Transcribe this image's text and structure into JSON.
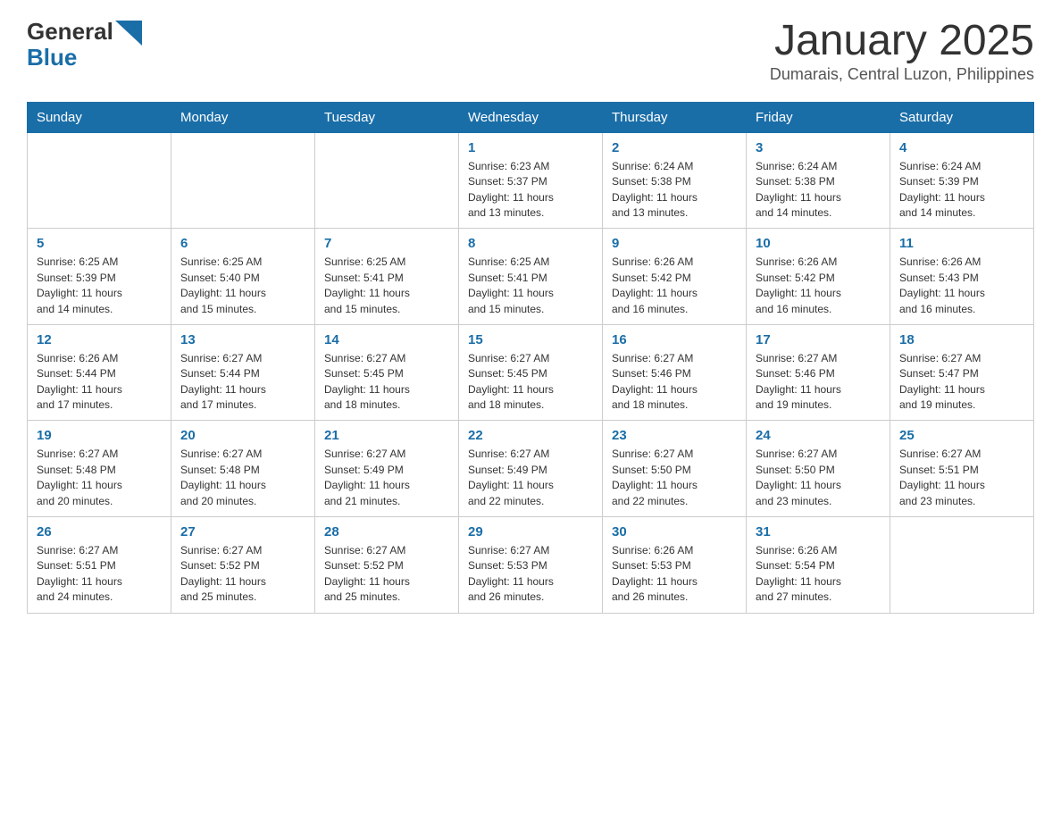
{
  "header": {
    "logo": {
      "text1": "General",
      "text2": "Blue"
    },
    "title": "January 2025",
    "location": "Dumarais, Central Luzon, Philippines"
  },
  "days_of_week": [
    "Sunday",
    "Monday",
    "Tuesday",
    "Wednesday",
    "Thursday",
    "Friday",
    "Saturday"
  ],
  "weeks": [
    {
      "days": [
        {
          "num": "",
          "info": ""
        },
        {
          "num": "",
          "info": ""
        },
        {
          "num": "",
          "info": ""
        },
        {
          "num": "1",
          "info": "Sunrise: 6:23 AM\nSunset: 5:37 PM\nDaylight: 11 hours\nand 13 minutes."
        },
        {
          "num": "2",
          "info": "Sunrise: 6:24 AM\nSunset: 5:38 PM\nDaylight: 11 hours\nand 13 minutes."
        },
        {
          "num": "3",
          "info": "Sunrise: 6:24 AM\nSunset: 5:38 PM\nDaylight: 11 hours\nand 14 minutes."
        },
        {
          "num": "4",
          "info": "Sunrise: 6:24 AM\nSunset: 5:39 PM\nDaylight: 11 hours\nand 14 minutes."
        }
      ]
    },
    {
      "days": [
        {
          "num": "5",
          "info": "Sunrise: 6:25 AM\nSunset: 5:39 PM\nDaylight: 11 hours\nand 14 minutes."
        },
        {
          "num": "6",
          "info": "Sunrise: 6:25 AM\nSunset: 5:40 PM\nDaylight: 11 hours\nand 15 minutes."
        },
        {
          "num": "7",
          "info": "Sunrise: 6:25 AM\nSunset: 5:41 PM\nDaylight: 11 hours\nand 15 minutes."
        },
        {
          "num": "8",
          "info": "Sunrise: 6:25 AM\nSunset: 5:41 PM\nDaylight: 11 hours\nand 15 minutes."
        },
        {
          "num": "9",
          "info": "Sunrise: 6:26 AM\nSunset: 5:42 PM\nDaylight: 11 hours\nand 16 minutes."
        },
        {
          "num": "10",
          "info": "Sunrise: 6:26 AM\nSunset: 5:42 PM\nDaylight: 11 hours\nand 16 minutes."
        },
        {
          "num": "11",
          "info": "Sunrise: 6:26 AM\nSunset: 5:43 PM\nDaylight: 11 hours\nand 16 minutes."
        }
      ]
    },
    {
      "days": [
        {
          "num": "12",
          "info": "Sunrise: 6:26 AM\nSunset: 5:44 PM\nDaylight: 11 hours\nand 17 minutes."
        },
        {
          "num": "13",
          "info": "Sunrise: 6:27 AM\nSunset: 5:44 PM\nDaylight: 11 hours\nand 17 minutes."
        },
        {
          "num": "14",
          "info": "Sunrise: 6:27 AM\nSunset: 5:45 PM\nDaylight: 11 hours\nand 18 minutes."
        },
        {
          "num": "15",
          "info": "Sunrise: 6:27 AM\nSunset: 5:45 PM\nDaylight: 11 hours\nand 18 minutes."
        },
        {
          "num": "16",
          "info": "Sunrise: 6:27 AM\nSunset: 5:46 PM\nDaylight: 11 hours\nand 18 minutes."
        },
        {
          "num": "17",
          "info": "Sunrise: 6:27 AM\nSunset: 5:46 PM\nDaylight: 11 hours\nand 19 minutes."
        },
        {
          "num": "18",
          "info": "Sunrise: 6:27 AM\nSunset: 5:47 PM\nDaylight: 11 hours\nand 19 minutes."
        }
      ]
    },
    {
      "days": [
        {
          "num": "19",
          "info": "Sunrise: 6:27 AM\nSunset: 5:48 PM\nDaylight: 11 hours\nand 20 minutes."
        },
        {
          "num": "20",
          "info": "Sunrise: 6:27 AM\nSunset: 5:48 PM\nDaylight: 11 hours\nand 20 minutes."
        },
        {
          "num": "21",
          "info": "Sunrise: 6:27 AM\nSunset: 5:49 PM\nDaylight: 11 hours\nand 21 minutes."
        },
        {
          "num": "22",
          "info": "Sunrise: 6:27 AM\nSunset: 5:49 PM\nDaylight: 11 hours\nand 22 minutes."
        },
        {
          "num": "23",
          "info": "Sunrise: 6:27 AM\nSunset: 5:50 PM\nDaylight: 11 hours\nand 22 minutes."
        },
        {
          "num": "24",
          "info": "Sunrise: 6:27 AM\nSunset: 5:50 PM\nDaylight: 11 hours\nand 23 minutes."
        },
        {
          "num": "25",
          "info": "Sunrise: 6:27 AM\nSunset: 5:51 PM\nDaylight: 11 hours\nand 23 minutes."
        }
      ]
    },
    {
      "days": [
        {
          "num": "26",
          "info": "Sunrise: 6:27 AM\nSunset: 5:51 PM\nDaylight: 11 hours\nand 24 minutes."
        },
        {
          "num": "27",
          "info": "Sunrise: 6:27 AM\nSunset: 5:52 PM\nDaylight: 11 hours\nand 25 minutes."
        },
        {
          "num": "28",
          "info": "Sunrise: 6:27 AM\nSunset: 5:52 PM\nDaylight: 11 hours\nand 25 minutes."
        },
        {
          "num": "29",
          "info": "Sunrise: 6:27 AM\nSunset: 5:53 PM\nDaylight: 11 hours\nand 26 minutes."
        },
        {
          "num": "30",
          "info": "Sunrise: 6:26 AM\nSunset: 5:53 PM\nDaylight: 11 hours\nand 26 minutes."
        },
        {
          "num": "31",
          "info": "Sunrise: 6:26 AM\nSunset: 5:54 PM\nDaylight: 11 hours\nand 27 minutes."
        },
        {
          "num": "",
          "info": ""
        }
      ]
    }
  ]
}
